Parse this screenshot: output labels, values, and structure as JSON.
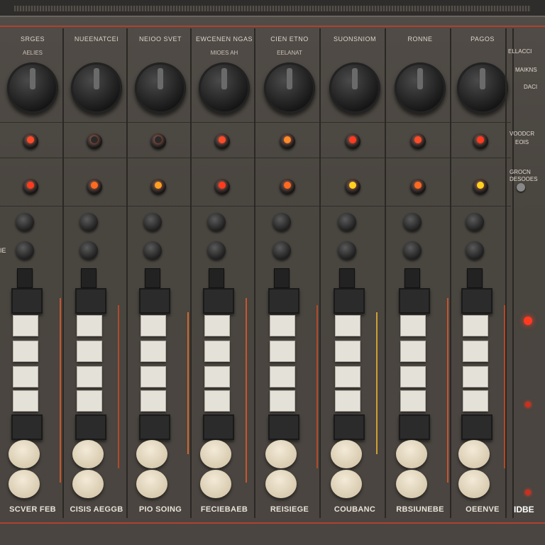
{
  "channels": [
    {
      "title": "SRGES",
      "sub": "AELIES",
      "bottom": "SCVER FEB",
      "led_mid": "#ff4a2a",
      "led_lower": "#ff3b1f"
    },
    {
      "title": "NUEENATCEI",
      "sub": "",
      "bottom": "CISIS AEGGB",
      "led_mid": "#2a2a2a",
      "led_lower": "#ff6a1f"
    },
    {
      "title": "NEIOO   SVET",
      "sub": "",
      "bottom": "PIO SOING",
      "led_mid": "#2a2a2a",
      "led_lower": "#ffa020"
    },
    {
      "title": "EWCENEN NGAS",
      "sub": "MIOES AH",
      "bottom": "FECIEBAEB",
      "led_mid": "#ff4a2a",
      "led_lower": "#ff3b1f"
    },
    {
      "title": "CIEN ETNO",
      "sub": "EELANAT",
      "bottom": "REISIEGE",
      "led_mid": "#ff8a2a",
      "led_lower": "#ff6a1f"
    },
    {
      "title": "SUONSNIOM",
      "sub": "",
      "bottom": "COUBANC",
      "led_mid": "#ff3a20",
      "led_lower": "#ffd21e"
    },
    {
      "title": "RONNE",
      "sub": "",
      "bottom": "RBSIUNEBE",
      "led_mid": "#ff4a2a",
      "led_lower": "#ff6a1f"
    },
    {
      "title": "PAGOS",
      "sub": "",
      "bottom": "OEENVE",
      "led_mid": "#ff3a20",
      "led_lower": "#ffd21e"
    }
  ],
  "side": {
    "label1": "ELLACCI",
    "label2": "MAIKNS",
    "label3": "DACI",
    "label4": "VOODCR",
    "label5": "EOIS",
    "label6": "GROCN",
    "label7": "DESOOES",
    "bottom": "IDBE"
  },
  "left_edge": {
    "label": "IE"
  },
  "colors": {
    "panel": "#4b4641",
    "accent_red": "#b0412e",
    "led_red": "#ff3a20",
    "led_yellow": "#ffd21e",
    "cap": "#e8dcc2"
  }
}
